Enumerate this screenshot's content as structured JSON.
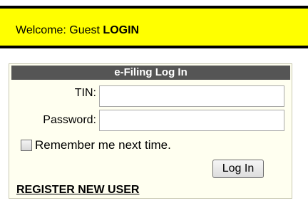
{
  "welcome": {
    "prefix": "Welcome: Guest ",
    "login_label": "LOGIN"
  },
  "panel": {
    "title": "e-Filing Log In",
    "tin_label": "TIN:",
    "tin_value": "",
    "password_label": "Password:",
    "password_value": "",
    "remember_label": "Remember me next time.",
    "remember_checked": false,
    "login_button_label": "Log In",
    "register_label": "REGISTER NEW USER"
  },
  "colors": {
    "welcome_bar": "#ffff00",
    "panel_title_bg": "#555555",
    "panel_bg": "#fffff0"
  }
}
